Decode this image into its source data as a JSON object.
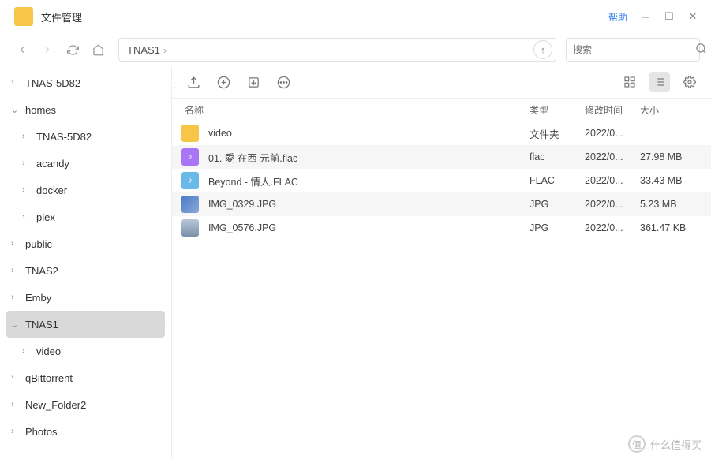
{
  "titlebar": {
    "title": "文件管理",
    "help": "帮助"
  },
  "toolbar": {
    "breadcrumb": [
      "TNAS1"
    ],
    "search_placeholder": "搜索"
  },
  "sidebar": {
    "items": [
      {
        "label": "TNAS-5D82",
        "level": 1,
        "expanded": false
      },
      {
        "label": "homes",
        "level": 1,
        "expanded": true
      },
      {
        "label": "TNAS-5D82",
        "level": 2,
        "expanded": false
      },
      {
        "label": "acandy",
        "level": 2,
        "expanded": false
      },
      {
        "label": "docker",
        "level": 2,
        "expanded": false
      },
      {
        "label": "plex",
        "level": 2,
        "expanded": false
      },
      {
        "label": "public",
        "level": 1,
        "expanded": false
      },
      {
        "label": "TNAS2",
        "level": 1,
        "expanded": false
      },
      {
        "label": "Emby",
        "level": 1,
        "expanded": false
      },
      {
        "label": "TNAS1",
        "level": 1,
        "expanded": true,
        "selected": true
      },
      {
        "label": "video",
        "level": 2,
        "expanded": false
      },
      {
        "label": "qBittorrent",
        "level": 1,
        "expanded": false
      },
      {
        "label": "New_Folder2",
        "level": 1,
        "expanded": false
      },
      {
        "label": "Photos",
        "level": 1,
        "expanded": false
      }
    ]
  },
  "columns": {
    "name": "名称",
    "type": "类型",
    "date": "修改时间",
    "size": "大小"
  },
  "files": [
    {
      "icon": "folder",
      "name": "video",
      "type": "文件夹",
      "date": "2022/0...",
      "size": ""
    },
    {
      "icon": "music",
      "name": "01. 愛 在西 元前.flac",
      "type": "flac",
      "date": "2022/0...",
      "size": "27.98 MB"
    },
    {
      "icon": "music2",
      "name": "Beyond - 情人.FLAC",
      "type": "FLAC",
      "date": "2022/0...",
      "size": "33.43 MB"
    },
    {
      "icon": "img1",
      "name": "IMG_0329.JPG",
      "type": "JPG",
      "date": "2022/0...",
      "size": "5.23 MB"
    },
    {
      "icon": "img2",
      "name": "IMG_0576.JPG",
      "type": "JPG",
      "date": "2022/0...",
      "size": "361.47 KB"
    }
  ],
  "watermark": {
    "logo": "值",
    "text": "什么值得买"
  }
}
